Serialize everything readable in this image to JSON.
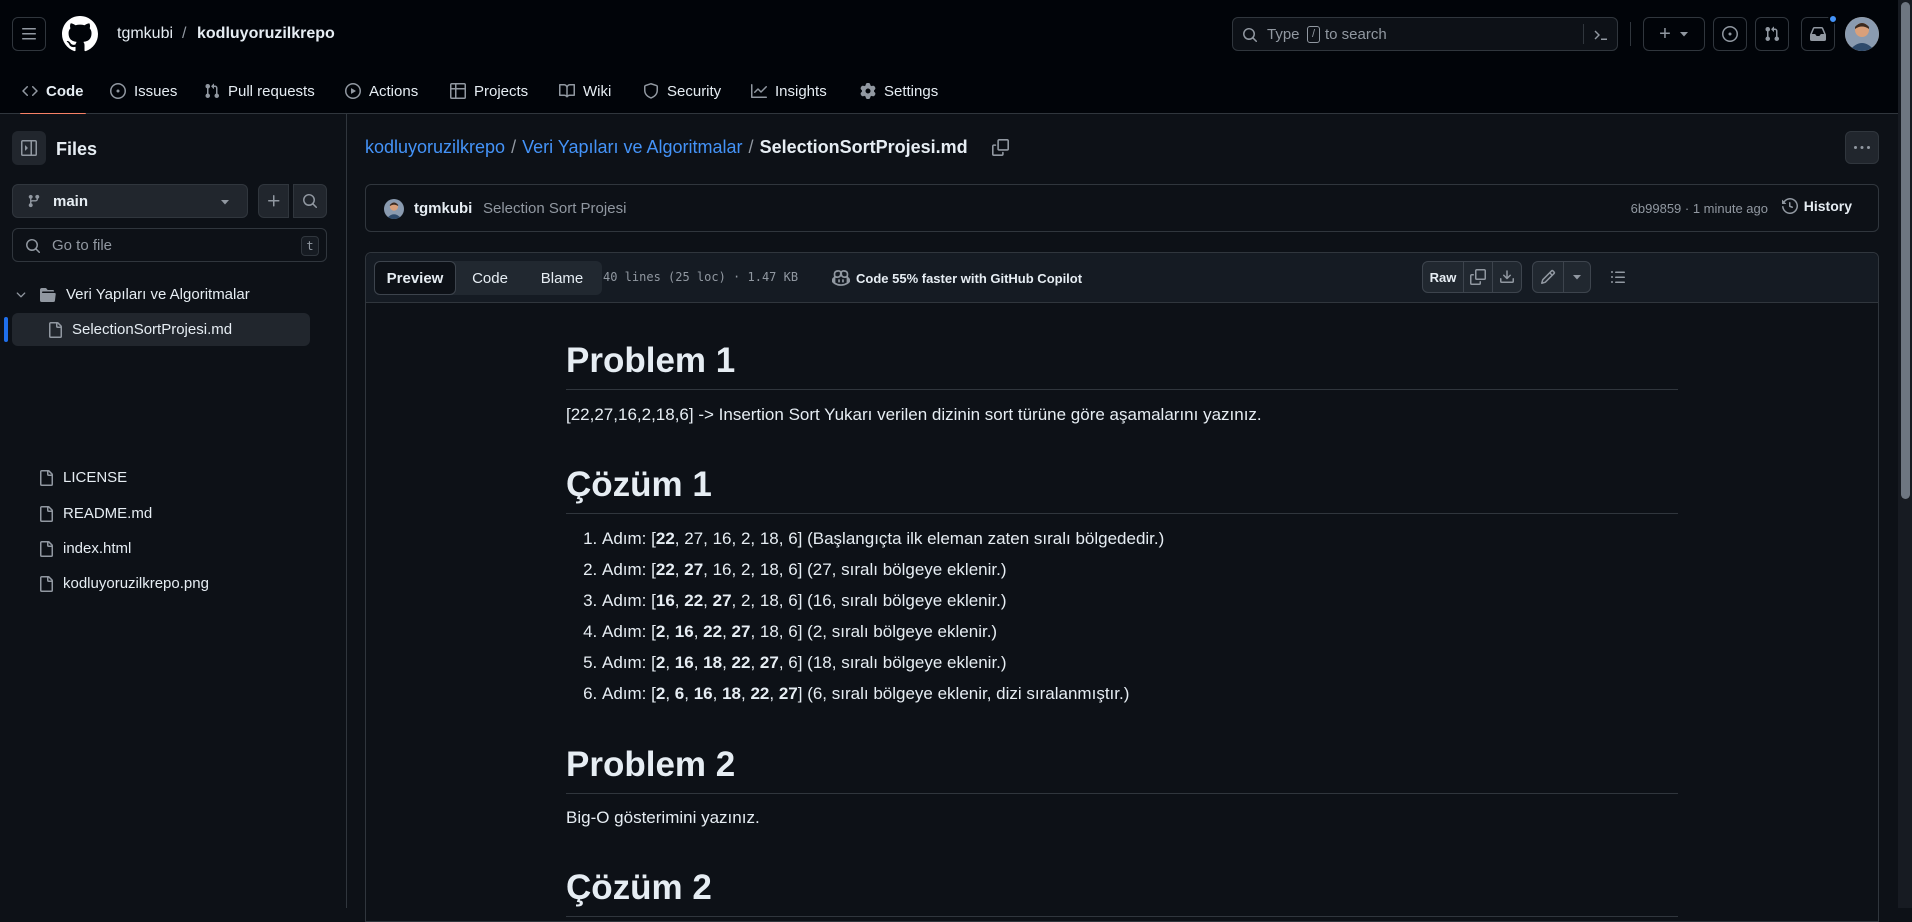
{
  "header": {
    "owner": "tgmkubi",
    "separator": "/",
    "repo": "kodluyoruzilkrepo",
    "search_prefix": "Type",
    "search_key": "/",
    "search_suffix": "to search",
    "create_label": "+"
  },
  "repo_nav": {
    "tabs": [
      {
        "label": "Code"
      },
      {
        "label": "Issues"
      },
      {
        "label": "Pull requests"
      },
      {
        "label": "Actions"
      },
      {
        "label": "Projects"
      },
      {
        "label": "Wiki"
      },
      {
        "label": "Security"
      },
      {
        "label": "Insights"
      },
      {
        "label": "Settings"
      }
    ]
  },
  "sidebar": {
    "title": "Files",
    "branch": "main",
    "goto_placeholder": "Go to file",
    "goto_shortcut": "t",
    "tree": [
      {
        "label": "Veri Yapıları ve Algoritmalar",
        "type": "folder"
      },
      {
        "label": "SelectionSortProjesi.md",
        "type": "file",
        "selected": true
      },
      {
        "label": "LICENSE",
        "type": "file"
      },
      {
        "label": "README.md",
        "type": "file"
      },
      {
        "label": "index.html",
        "type": "file"
      },
      {
        "label": "kodluyoruzilkrepo.png",
        "type": "file"
      }
    ]
  },
  "breadcrumb": {
    "repo": "kodluyoruzilkrepo",
    "sep1": "/",
    "folder": "Veri Yapıları ve Algoritmalar",
    "sep2": "/",
    "file": "SelectionSortProjesi.md"
  },
  "commit": {
    "author": "tgmkubi",
    "message": "Selection Sort Projesi",
    "meta": "6b99859 · 1 minute ago",
    "history_label": "History"
  },
  "file_toolbar": {
    "tabs": [
      "Preview",
      "Code",
      "Blame"
    ],
    "info": "40 lines (25 loc) · 1.47 KB",
    "copilot": "Code 55% faster with GitHub Copilot",
    "raw_label": "Raw"
  },
  "content": {
    "h1_problem1": "Problem 1",
    "p_problem1": "[22,27,16,2,18,6] -> Insertion Sort Yukarı verilen dizinin sort türüne göre aşamalarını yazınız.",
    "h1_cozum1": "Çözüm 1",
    "steps": [
      {
        "prefix": "Adım: [",
        "bold": [
          "22"
        ],
        "rest": ", 27, 16, 2, 18, 6]",
        "note": " (Başlangıçta ilk eleman zaten sıralı bölgededir.)"
      },
      {
        "prefix": "Adım: [",
        "bold": [
          "22",
          "27"
        ],
        "rest": ", 16, 2, 18, 6]",
        "note": " (27, sıralı bölgeye eklenir.)"
      },
      {
        "prefix": "Adım: [",
        "bold": [
          "16",
          "22",
          "27"
        ],
        "rest": ", 2, 18, 6]",
        "note": " (16, sıralı bölgeye eklenir.)"
      },
      {
        "prefix": "Adım: [",
        "bold": [
          "2",
          "16",
          "22",
          "27"
        ],
        "rest": ", 18, 6]",
        "note": " (2, sıralı bölgeye eklenir.)"
      },
      {
        "prefix": "Adım: [",
        "bold": [
          "2",
          "16",
          "18",
          "22",
          "27"
        ],
        "rest": ", 6]",
        "note": " (18, sıralı bölgeye eklenir.)"
      },
      {
        "prefix": "Adım: [",
        "bold": [
          "2",
          "6",
          "16",
          "18",
          "22",
          "27"
        ],
        "rest": "]",
        "note": " (6, sıralı bölgeye eklenir, dizi sıralanmıştır.)"
      }
    ],
    "h1_problem2": "Problem 2",
    "p_problem2": "Big-O gösterimini yazınız.",
    "h1_cozum2": "Çözüm 2"
  },
  "colors": {
    "accent_link": "#4493f8",
    "tab_underline": "#f78166",
    "selected_marker": "#1f6feb"
  }
}
